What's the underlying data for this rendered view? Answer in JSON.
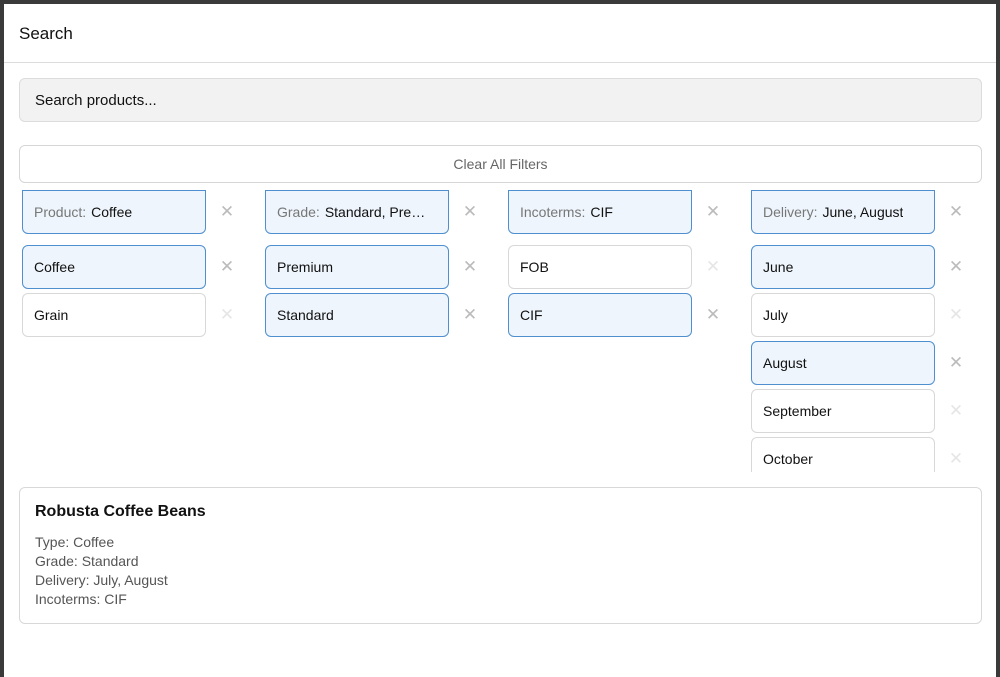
{
  "header": {
    "title": "Search"
  },
  "search": {
    "placeholder": "Search products..."
  },
  "clear_label": "Clear All Filters",
  "filters": [
    {
      "label": "Product:",
      "value": "Coffee",
      "options": [
        {
          "label": "Coffee",
          "selected": true
        },
        {
          "label": "Grain",
          "selected": false
        }
      ]
    },
    {
      "label": "Grade:",
      "value": "Standard, Premium",
      "options": [
        {
          "label": "Premium",
          "selected": true
        },
        {
          "label": "Standard",
          "selected": true
        }
      ]
    },
    {
      "label": "Incoterms:",
      "value": "CIF",
      "options": [
        {
          "label": "FOB",
          "selected": false
        },
        {
          "label": "CIF",
          "selected": true
        }
      ]
    },
    {
      "label": "Delivery:",
      "value": "June, August",
      "options": [
        {
          "label": "June",
          "selected": true
        },
        {
          "label": "July",
          "selected": false
        },
        {
          "label": "August",
          "selected": true
        },
        {
          "label": "September",
          "selected": false
        },
        {
          "label": "October",
          "selected": false
        }
      ]
    }
  ],
  "result": {
    "title": "Robusta Coffee Beans",
    "lines": [
      "Type: Coffee",
      "Grade: Standard",
      "Delivery: July, August",
      "Incoterms: CIF"
    ]
  },
  "icons": {
    "remove": "close-icon"
  }
}
